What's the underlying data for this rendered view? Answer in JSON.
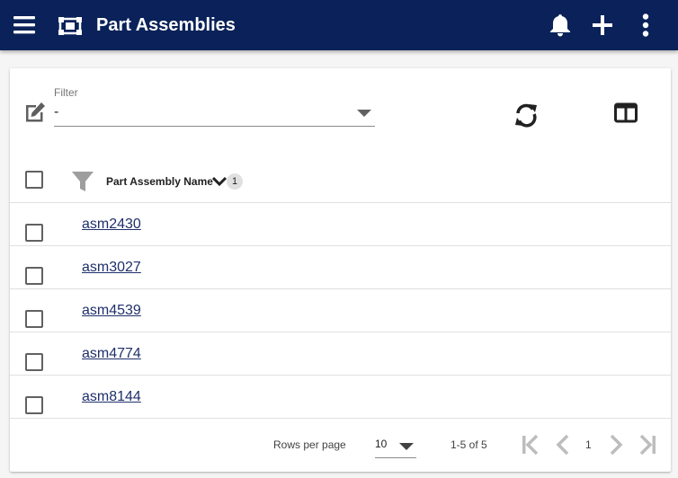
{
  "appbar": {
    "title": "Part Assemblies",
    "background": "#0a2259"
  },
  "filter": {
    "label": "Filter",
    "value": "-"
  },
  "table": {
    "column_title": "Part Assembly Name",
    "sort_badge": "1",
    "rows": [
      {
        "name": "asm2430"
      },
      {
        "name": "asm3027"
      },
      {
        "name": "asm4539"
      },
      {
        "name": "asm4774"
      },
      {
        "name": "asm8144"
      }
    ]
  },
  "pagination": {
    "rows_per_page_label": "Rows per page",
    "rows_per_page_value": "10",
    "range_text": "1-5 of 5",
    "page_number": "1"
  },
  "icons": {
    "menu": "menu-icon",
    "app": "assembly-icon",
    "bell": "bell-icon",
    "add": "plus-icon",
    "more": "more-vertical-icon",
    "edit": "edit-icon",
    "refresh": "refresh-icon",
    "columns": "columns-icon",
    "filter": "funnel-icon",
    "sort": "chevron-down-icon"
  }
}
